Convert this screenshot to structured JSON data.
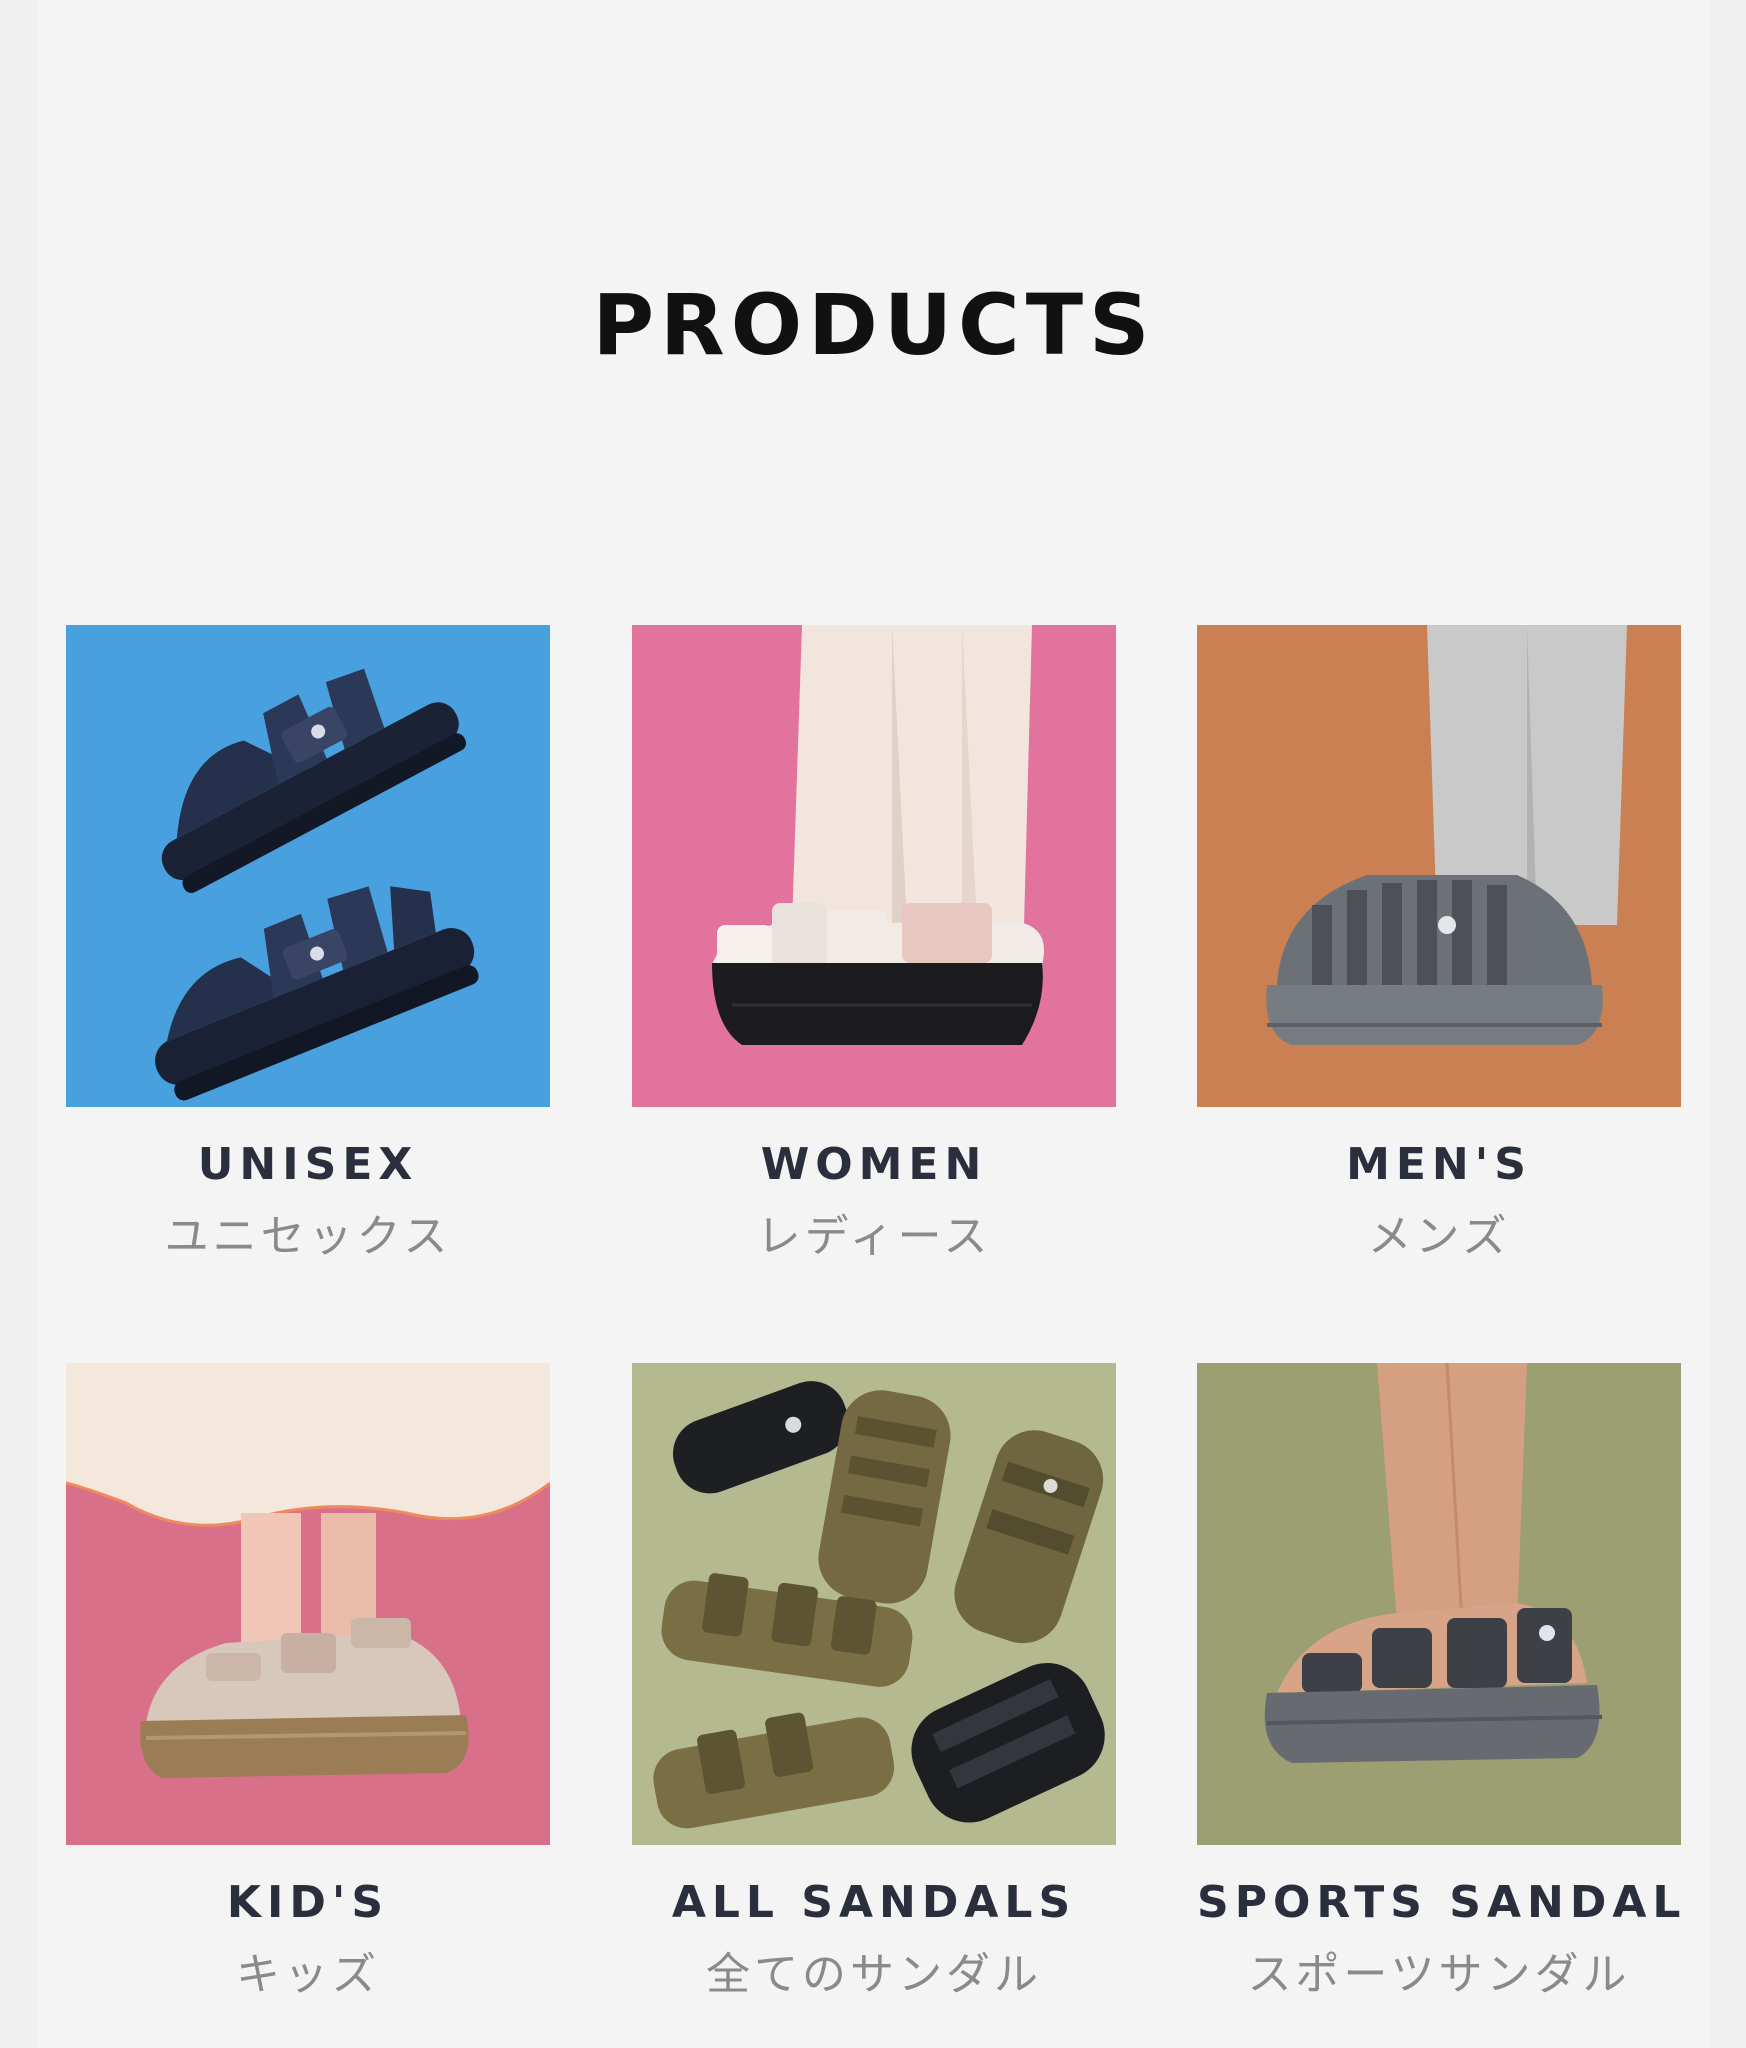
{
  "section": {
    "title": "PRODUCTS"
  },
  "categories": [
    {
      "label_en": "UNISEX",
      "label_jp": "ユニセックス",
      "bg": "#4aa6e0"
    },
    {
      "label_en": "WOMEN",
      "label_jp": "レディース",
      "bg": "#e97ea6"
    },
    {
      "label_en": "MEN'S",
      "label_jp": "メンズ",
      "bg": "#cf8659"
    },
    {
      "label_en": "KID'S",
      "label_jp": "キッズ",
      "bg": "#d66d86"
    },
    {
      "label_en": "ALL SANDALS",
      "label_jp": "全てのサンダル",
      "bg": "#b8bb95"
    },
    {
      "label_en": "SPORTS SANDAL",
      "label_jp": "スポーツサンダル",
      "bg": "#9da274"
    }
  ]
}
